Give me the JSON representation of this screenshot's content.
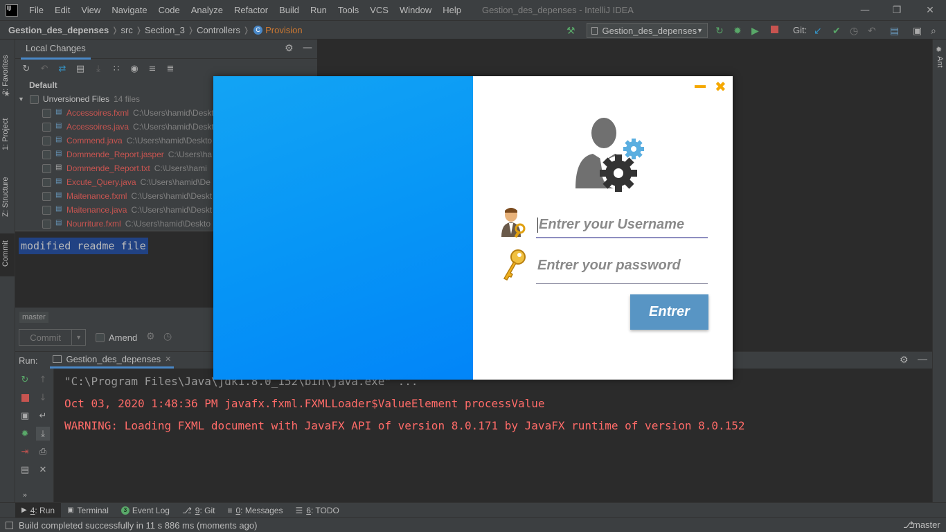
{
  "window": {
    "title": "Gestion_des_depenses - IntelliJ IDEA",
    "menu": [
      "File",
      "Edit",
      "View",
      "Navigate",
      "Code",
      "Analyze",
      "Refactor",
      "Build",
      "Run",
      "Tools",
      "VCS",
      "Window",
      "Help"
    ]
  },
  "navbar": {
    "project": "Gestion_des_depenses",
    "crumbs": [
      "src",
      "Section_3",
      "Controllers"
    ],
    "current": "Provision",
    "run_config": "Gestion_des_depenses",
    "git_label": "Git:"
  },
  "left_stripe": {
    "tabs": [
      "2: Favorites",
      "1: Project",
      "Z: Structure",
      "Commit"
    ]
  },
  "right_stripe": {
    "tab": "Ant"
  },
  "commit_panel": {
    "tab": "Local Changes",
    "group": "Default",
    "unversioned_label": "Unversioned Files",
    "unversioned_count": "14 files",
    "files": [
      {
        "name": "Accessoires.fxml",
        "path": "C:\\Users\\hamid\\Deskt"
      },
      {
        "name": "Accessoires.java",
        "path": "C:\\Users\\hamid\\Deskt"
      },
      {
        "name": "Commend.java",
        "path": "C:\\Users\\hamid\\Deskto"
      },
      {
        "name": "Dommende_Report.jasper",
        "path": "C:\\Users\\ha"
      },
      {
        "name": "Dommende_Report.txt",
        "path": "C:\\Users\\hami"
      },
      {
        "name": "Excute_Query.java",
        "path": "C:\\Users\\hamid\\De"
      },
      {
        "name": "Maitenance.fxml",
        "path": "C:\\Users\\hamid\\Deskt"
      },
      {
        "name": "Maitenance.java",
        "path": "C:\\Users\\hamid\\Deskt"
      },
      {
        "name": "Nourriture.fxml",
        "path": "C:\\Users\\hamid\\Deskto"
      }
    ],
    "message": "modified readme file",
    "branch": "master",
    "commit_button": "Commit",
    "amend_label": "Amend"
  },
  "run_panel": {
    "label": "Run:",
    "tab": "Gestion_des_depenses",
    "lines": [
      "\"C:\\Program Files\\Java\\jdk1.8.0_152\\bin\\java.exe\" ...",
      "Oct 03, 2020 1:48:36 PM javafx.fxml.FXMLLoader$ValueElement processValue",
      "WARNING: Loading FXML document with JavaFX API of version 8.0.171 by JavaFX runtime of version 8.0.152"
    ]
  },
  "bottom_tabs": [
    {
      "num": "4",
      "label": ": Run"
    },
    {
      "num": "",
      "label": "Terminal"
    },
    {
      "num": "",
      "label": "Event Log"
    },
    {
      "num": "9",
      "label": ": Git"
    },
    {
      "num": "0",
      "label": ": Messages"
    },
    {
      "num": "6",
      "label": ": TODO"
    }
  ],
  "status": {
    "message": "Build completed successfully in 11 s 886 ms (moments ago)",
    "branch": "master"
  },
  "login": {
    "username_placeholder": "Entrer your Username",
    "password_placeholder": "Entrer your password",
    "button": "Entrer",
    "colors": {
      "gradient_start": "#13a4f4",
      "gradient_end": "#0285f8",
      "button": "#5895c4",
      "controls": "#f5a800"
    }
  }
}
